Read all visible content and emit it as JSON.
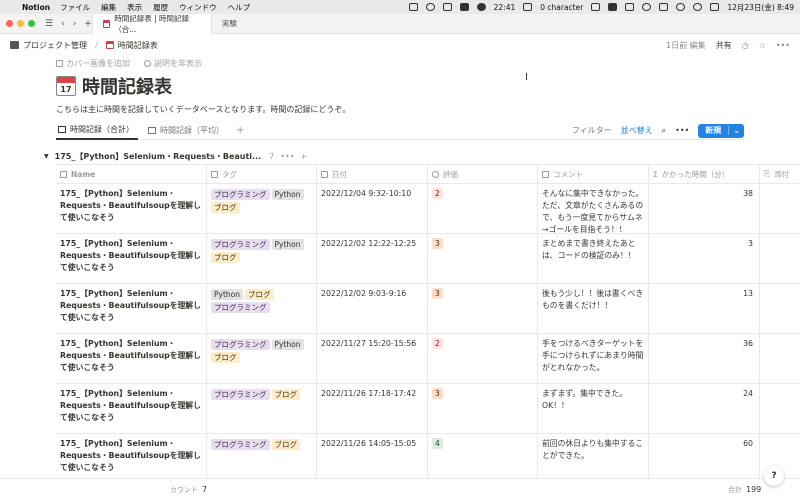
{
  "menubar": {
    "app": "Notion",
    "items": [
      "ファイル",
      "編集",
      "表示",
      "履歴",
      "ウィンドウ",
      "ヘルプ"
    ],
    "clock": "22:41",
    "char_count": "0 character",
    "datetime": "12月23日(金) 8:49"
  },
  "tabs": {
    "active": "時間記録表 | 時間記録（合...",
    "inactive": "実験"
  },
  "topbar": {
    "crumb_parent": "プロジェクト管理",
    "crumb_current": "時間記録表",
    "edited": "1日前 編集",
    "share": "共有"
  },
  "page": {
    "add_cover": "カバー画像を追加",
    "hide_desc": "説明を非表示",
    "calendar_day": "17",
    "title": "時間記録表",
    "description": "こちらは主に時間を記録していくデータベースとなります。時間の記録にどうぞ。"
  },
  "views": {
    "tab1": "時間記録（合計）",
    "tab2": "時間記録（平均）",
    "filter": "フィルター",
    "sort": "並べ替え",
    "new": "新規"
  },
  "group": {
    "name": "175_【Python】Selenium・Requests・Beauti...",
    "count": "7"
  },
  "columns": [
    "Name",
    "タグ",
    "日付",
    "評価",
    "コメント",
    "かかった時間（分）",
    "添付"
  ],
  "rows": [
    {
      "name": "175_【Python】Selenium・Requests・Beautifulsoupを理解して使いこなそう",
      "tags": [
        [
          "プログラミング",
          "prog"
        ],
        [
          "Python",
          "py"
        ],
        [
          "ブログ",
          "blog"
        ]
      ],
      "date": "2022/12/04 9:32-10:10",
      "rating": "2",
      "rating_color": "red",
      "comment": "そんなに集中できなかった。ただ、文章がたくさんあるので、もう一度見てからサムネ→ゴールを目指そう！！",
      "time": "38"
    },
    {
      "name": "175_【Python】Selenium・Requests・Beautifulsoupを理解して使いこなそう",
      "tags": [
        [
          "プログラミング",
          "prog"
        ],
        [
          "Python",
          "py"
        ],
        [
          "ブログ",
          "blog"
        ]
      ],
      "date": "2022/12/02 12:22-12:25",
      "rating": "3",
      "rating_color": "orange",
      "comment": "まとめまで書き終えたあとは、コードの検証のみ！！",
      "time": "3"
    },
    {
      "name": "175_【Python】Selenium・Requests・Beautifulsoupを理解して使いこなそう",
      "tags": [
        [
          "Python",
          "py"
        ],
        [
          "ブログ",
          "blog"
        ],
        [
          "プログラミング",
          "prog"
        ]
      ],
      "date": "2022/12/02 9:03-9:16",
      "rating": "3",
      "rating_color": "orange",
      "comment": "後もう少し！！後は書くべきものを書くだけ！！",
      "time": "13"
    },
    {
      "name": "175_【Python】Selenium・Requests・Beautifulsoupを理解して使いこなそう",
      "tags": [
        [
          "プログラミング",
          "prog"
        ],
        [
          "Python",
          "py"
        ],
        [
          "ブログ",
          "blog"
        ]
      ],
      "date": "2022/11/27 15:20-15:56",
      "rating": "2",
      "rating_color": "red",
      "comment": "手をつけるべきターゲットを手につけられずにあまり時間がとれなかった。",
      "time": "36"
    },
    {
      "name": "175_【Python】Selenium・Requests・Beautifulsoupを理解して使いこなそう",
      "tags": [
        [
          "プログラミング",
          "prog"
        ],
        [
          "ブログ",
          "blog"
        ]
      ],
      "date": "2022/11/26 17:18-17:42",
      "rating": "3",
      "rating_color": "orange",
      "comment": "まずまず。集中できた。OK！！",
      "time": "24"
    },
    {
      "name": "175_【Python】Selenium・Requests・Beautifulsoupを理解して使いこなそう",
      "tags": [
        [
          "プログラミング",
          "prog"
        ],
        [
          "ブログ",
          "blog"
        ]
      ],
      "date": "2022/11/26 14:05-15:05",
      "rating": "4",
      "rating_color": "green",
      "comment": "前回の休日よりも集中することができた。",
      "time": "60"
    }
  ],
  "footer": {
    "count_label": "カウント",
    "count_value": "7",
    "sum_label": "合計",
    "sum_value": "199"
  },
  "help": "?",
  "colors": {
    "accent": "#2383e2",
    "red_light": "#ff5f57",
    "yellow_light": "#febc2e",
    "green_light": "#28c840"
  }
}
